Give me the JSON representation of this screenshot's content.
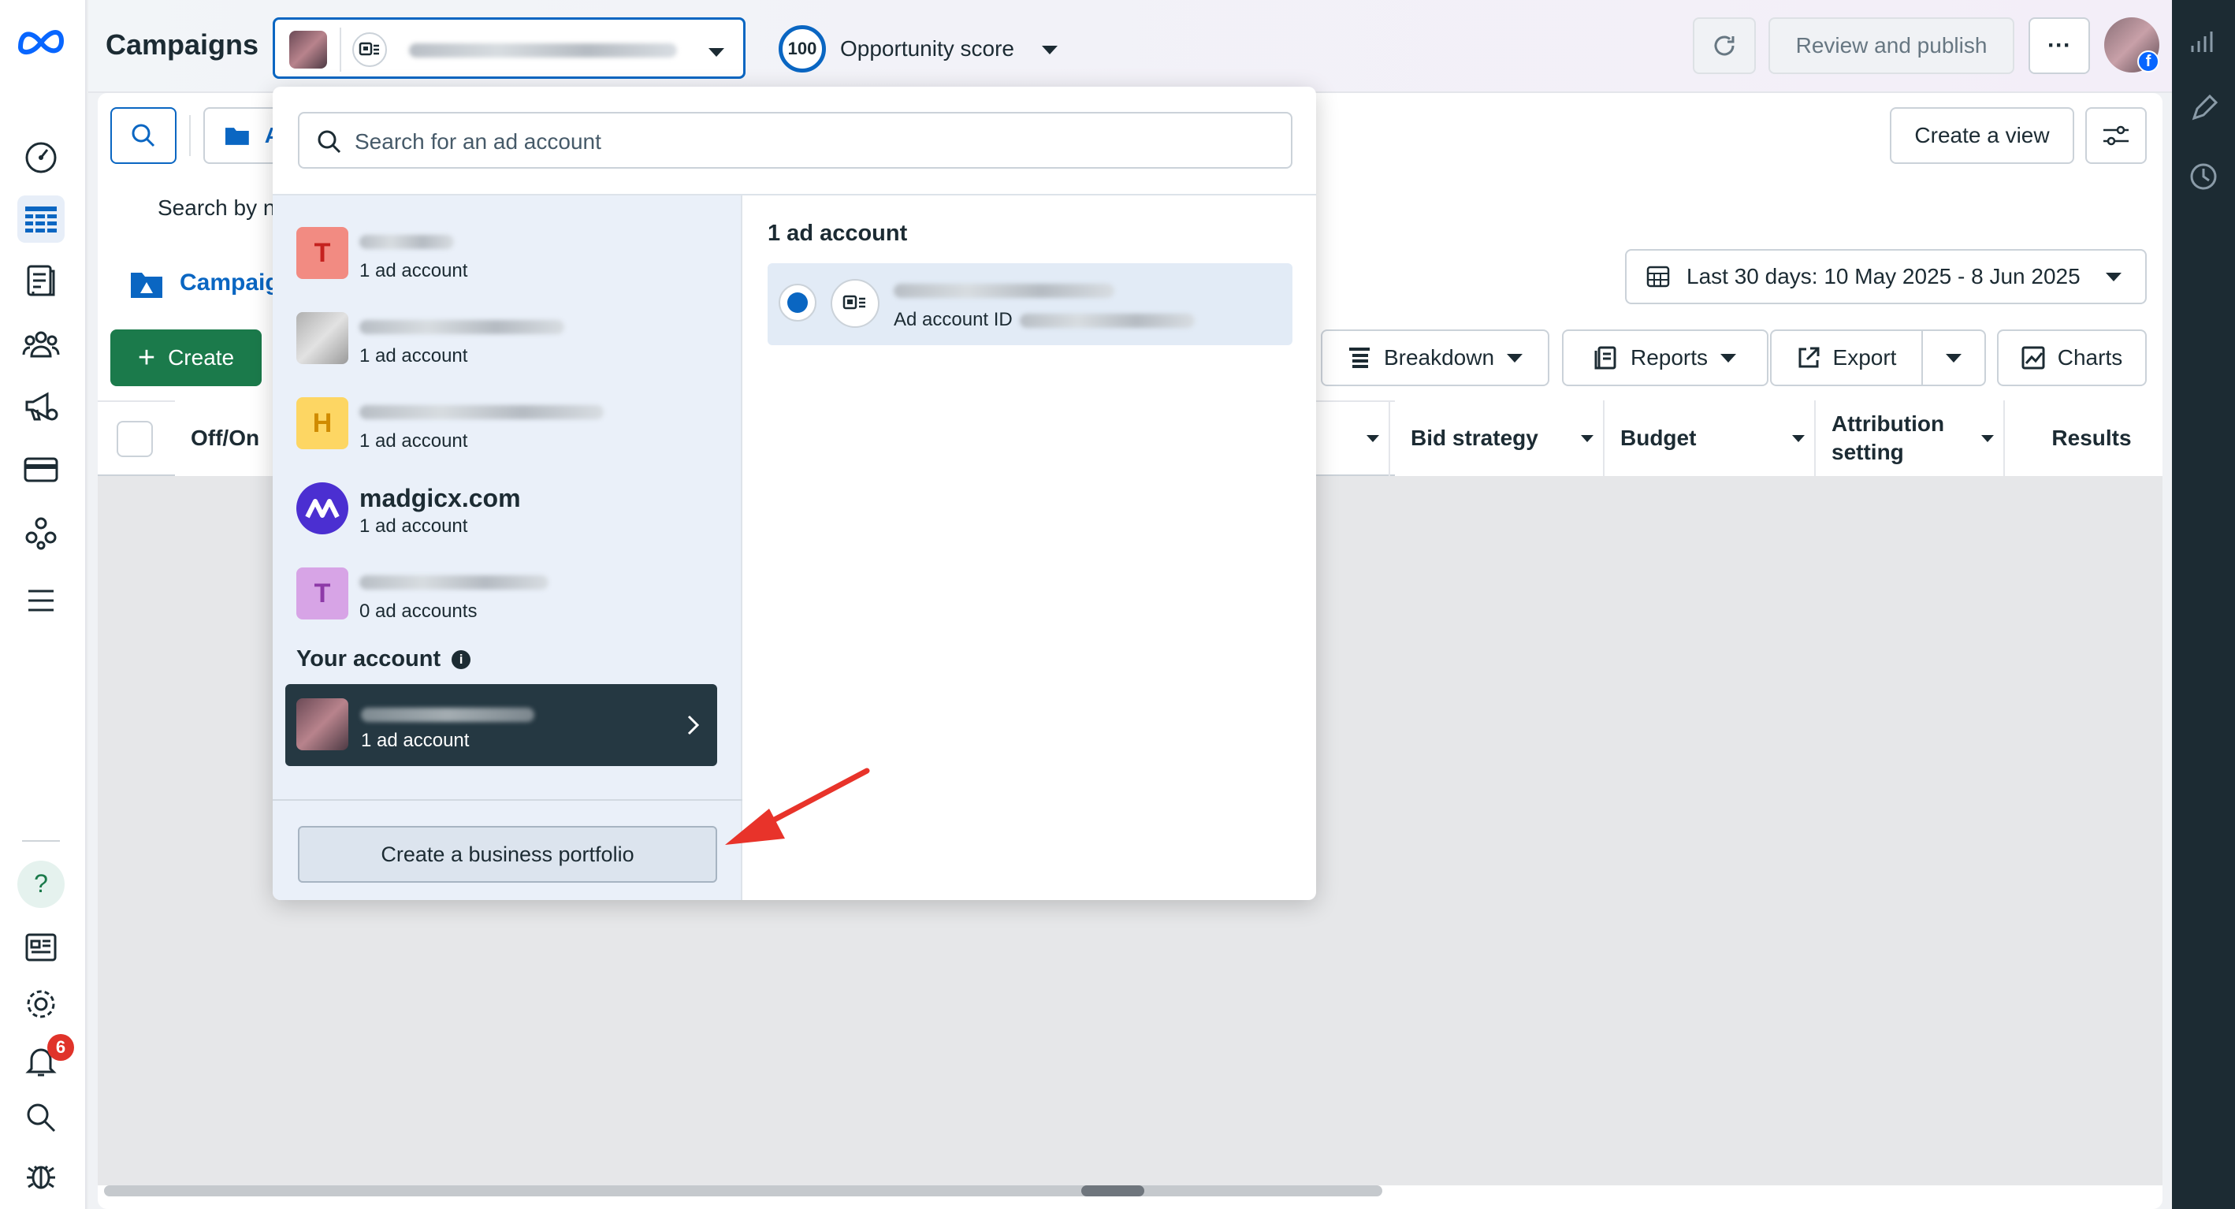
{
  "header": {
    "title": "Campaigns",
    "opportunity_score_value": "100",
    "opportunity_score_label": "Opportunity score",
    "review_publish": "Review and publish",
    "more": "···"
  },
  "toolbar": {
    "search_placeholder": "Search by n",
    "create_view": "Create a view",
    "folder_tab_letter": "A",
    "campaigns_tab": "Campaig",
    "date_range": "Last 30 days: 10 May 2025 - 8 Jun 2025",
    "create": "Create",
    "breakdown": "Breakdown",
    "reports": "Reports",
    "export": "Export",
    "charts": "Charts"
  },
  "table": {
    "columns": [
      "Off/On",
      "Bid strategy",
      "Budget",
      "Attribution setting",
      "Results"
    ]
  },
  "dropdown": {
    "search_placeholder": "Search for an ad account",
    "portfolios": [
      {
        "initial": "T",
        "sub": "1 ad account",
        "name": "",
        "color": "#f28b82"
      },
      {
        "initial": "",
        "sub": "1 ad account",
        "name": "",
        "color": "#c9c9c9"
      },
      {
        "initial": "H",
        "sub": "1 ad account",
        "name": "",
        "color": "#fdd663"
      },
      {
        "initial": "",
        "sub": "1 ad account",
        "name": "madgicx.com",
        "color": "#4b2fd1"
      },
      {
        "initial": "T",
        "sub": "0 ad accounts",
        "name": "",
        "color": "#d7a4e6"
      }
    ],
    "your_account_label": "Your account",
    "your_account_sub": "1 ad account",
    "create_portfolio": "Create a business portfolio",
    "right_heading": "1 ad account",
    "ad_account_id_label": "Ad account ID"
  },
  "notifications": {
    "badge": "6"
  },
  "colors": {
    "accent": "#0a66c2",
    "create_button": "#1b7a4b",
    "arrow": "#e8332a",
    "badge": "#e0332a"
  }
}
